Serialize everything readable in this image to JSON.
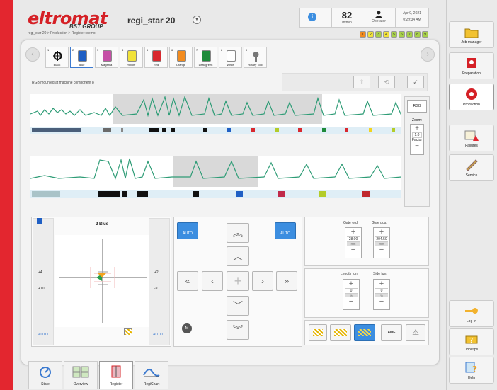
{
  "header": {
    "brand": "eltromat",
    "brand_sub": "BST GROUP",
    "machine": "regi_star 20",
    "value": "82",
    "value_label": "m/min",
    "user_label": "Operator",
    "date": "Apr 9, 2021",
    "time": "0:29:34 AM",
    "breadcrumb": "regi_star 20 > Production > Register: demo"
  },
  "cut_points": [
    "1",
    "2",
    "3",
    "4",
    "5",
    "6",
    "7",
    "8",
    "9"
  ],
  "colors": [
    {
      "num": "1",
      "name": "Black",
      "hex": "#111111"
    },
    {
      "num": "2",
      "name": "Blue",
      "hex": "#1f5fc4"
    },
    {
      "num": "3",
      "name": "Magenta",
      "hex": "#c54fa6"
    },
    {
      "num": "4",
      "name": "Yellow",
      "hex": "#f1e23a"
    },
    {
      "num": "5",
      "name": "Red",
      "hex": "#d8282e"
    },
    {
      "num": "6",
      "name": "Orange",
      "hex": "#f28b1e"
    },
    {
      "num": "7",
      "name": "Dark green",
      "hex": "#1e8a3a"
    },
    {
      "num": "8",
      "name": "White",
      "hex": "#ffffff"
    },
    {
      "num": "9",
      "name": "Rotary Tool",
      "hex": "#888888"
    }
  ],
  "description": "RGB mounted at machine component 8",
  "zoom": {
    "rgb_label": "RGB",
    "zoom_label": "Zoom:",
    "value": "1.0",
    "factor_label": "Factor"
  },
  "register_view": {
    "title": "2 Blue",
    "left_top": "+4",
    "left_bottom": "+10",
    "right_top": "+2",
    "right_bottom": "-9",
    "auto": "AUTO"
  },
  "controls": {
    "auto_left": "AUTO",
    "auto_right": "AUTO",
    "m_label": "M"
  },
  "gate": {
    "width_label": "Gate wid.",
    "width_value": "28.00",
    "width_unit": "mm",
    "pos_label": "Gate pos.",
    "pos_value": "204.50",
    "pos_unit": "mm"
  },
  "tune": {
    "length_label": "Length fun.",
    "length_value": "0",
    "length_unit": "%",
    "side_label": "Side fun.",
    "side_value": "0",
    "side_unit": "%"
  },
  "bottom_tools": {
    "ame": "AME"
  },
  "bottom_tabs": [
    "State",
    "Overview",
    "Register",
    "RegiChart"
  ],
  "sidebar": [
    "Job manager",
    "Preparation",
    "Production",
    "Failures",
    "Service",
    "Log-In",
    "Tool tips",
    "Help"
  ]
}
